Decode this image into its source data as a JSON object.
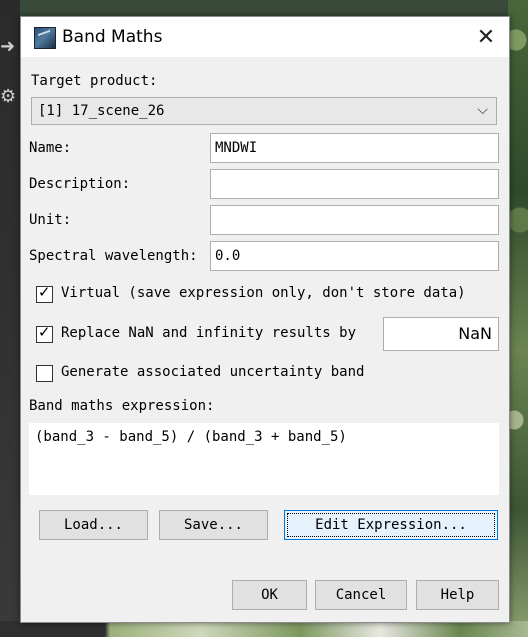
{
  "window": {
    "title": "Band Maths",
    "close_glyph": "✕"
  },
  "form": {
    "target_product_label": "Target product:",
    "target_product_value": "[1] 17_scene_26",
    "name_label": "Name:",
    "name_value": "MNDWI",
    "description_label": "Description:",
    "description_value": "",
    "unit_label": "Unit:",
    "unit_value": "",
    "wavelength_label": "Spectral wavelength:",
    "wavelength_value": "0.0",
    "virtual_checked": true,
    "virtual_label": "Virtual (save expression only, don't store data)",
    "replace_nan_checked": true,
    "replace_nan_label": "Replace NaN and infinity results by",
    "replace_nan_value": "NaN",
    "uncertainty_checked": false,
    "uncertainty_label": "Generate associated uncertainty band",
    "expression_label": "Band maths expression:",
    "expression_value": "(band_3 - band_5) / (band_3 + band_5)"
  },
  "buttons": {
    "load": "Load...",
    "save": "Save...",
    "edit_expression": "Edit Expression...",
    "ok": "OK",
    "cancel": "Cancel",
    "help": "Help"
  },
  "icons": {
    "app": "snap-app-icon",
    "close": "close-icon",
    "dropdown": "chevron-down-icon",
    "check": "checkmark-icon"
  },
  "colors": {
    "dialog_bg": "#f0f0f0",
    "titlebar_bg": "#ffffff",
    "focus_border": "#0078d7"
  }
}
